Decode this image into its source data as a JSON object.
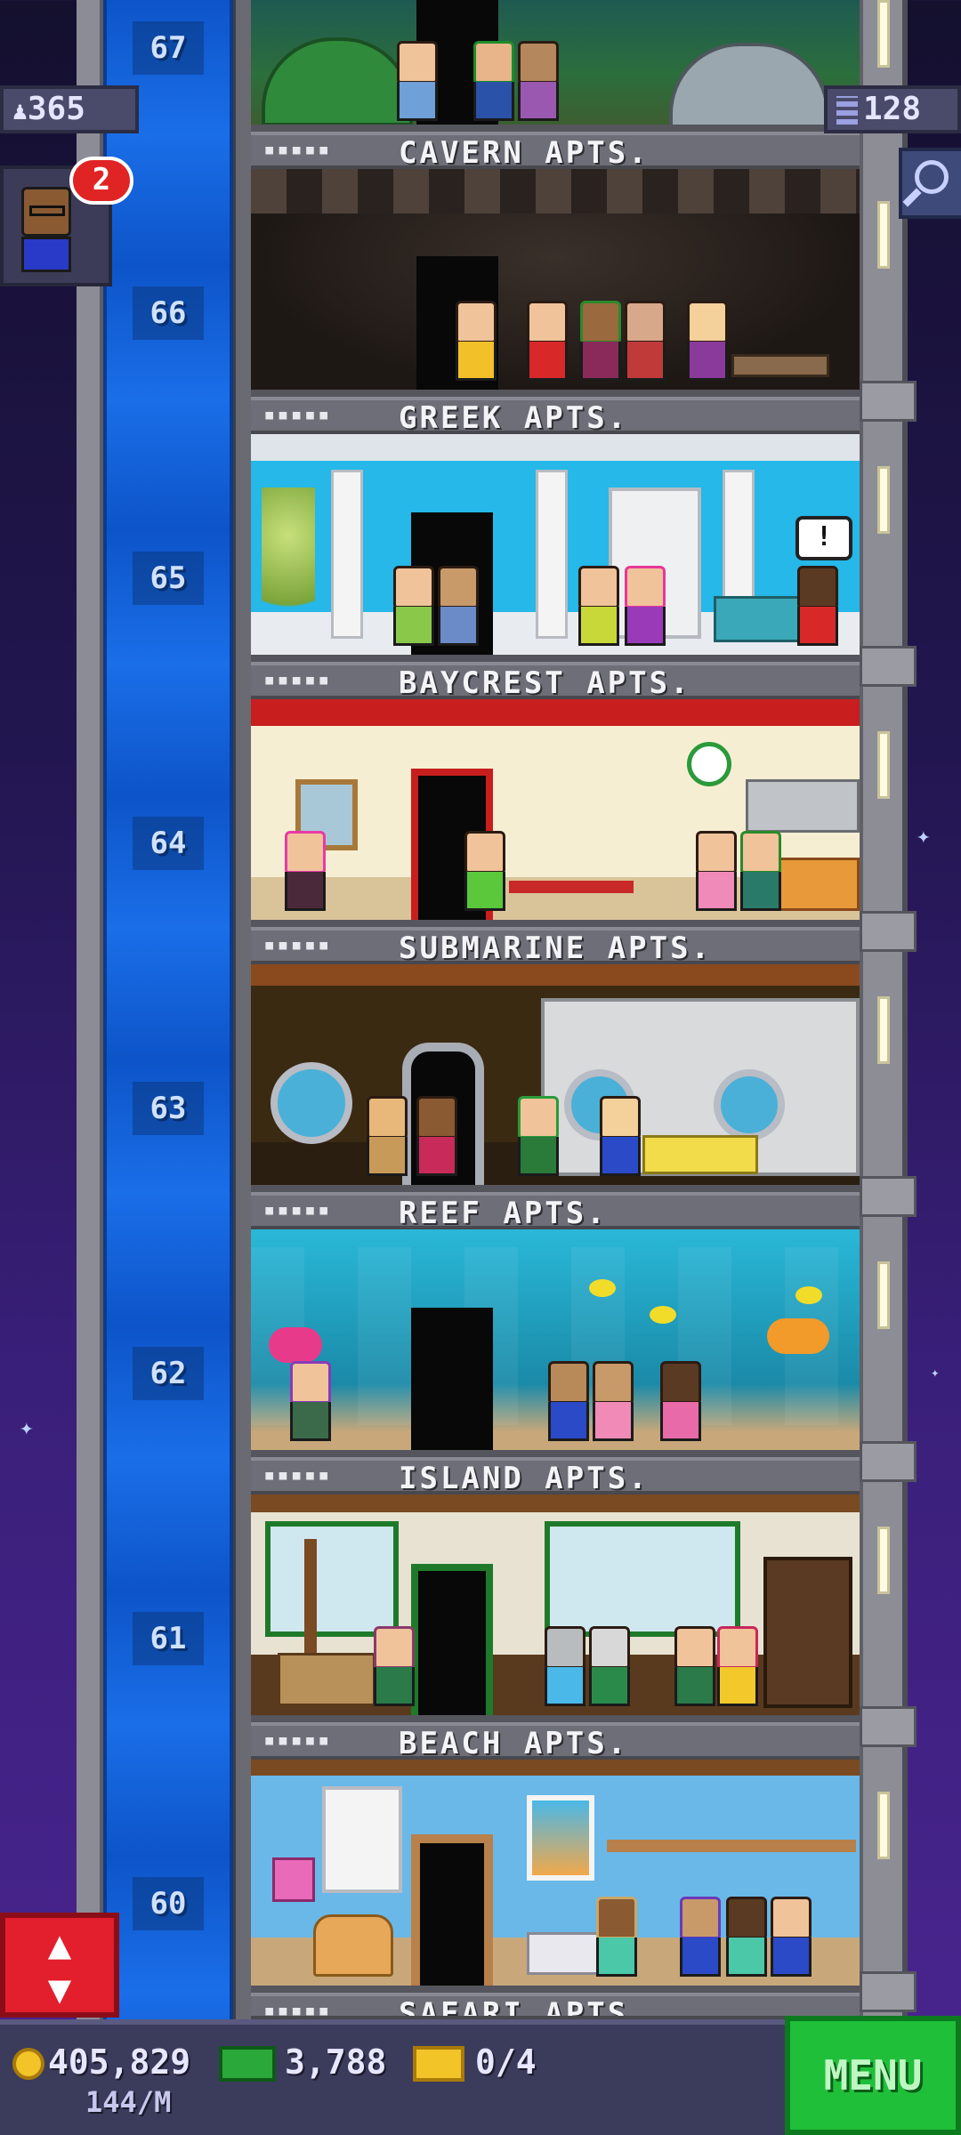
{
  "hud": {
    "population": "365",
    "floors": "128",
    "vip_badge_count": "2",
    "population_icon": "person-icon",
    "floors_icon": "building-icon",
    "search_icon": "magnifier-icon"
  },
  "floors": [
    {
      "number": "67",
      "name": "CAVERN APTS.",
      "stars": "▪▪▪▪▪"
    },
    {
      "number": "66",
      "name": "GREEK APTS.",
      "stars": "▪▪▪▪▪"
    },
    {
      "number": "65",
      "name": "BAYCREST APTS.",
      "stars": "▪▪▪▪▪"
    },
    {
      "number": "64",
      "name": "SUBMARINE APTS.",
      "stars": "▪▪▪▪▪"
    },
    {
      "number": "63",
      "name": "REEF APTS.",
      "stars": "▪▪▪▪▪"
    },
    {
      "number": "62",
      "name": "ISLAND APTS.",
      "stars": "▪▪▪▪▪"
    },
    {
      "number": "61",
      "name": "BEACH APTS.",
      "stars": "▪▪▪▪▪"
    },
    {
      "number": "60",
      "name": "SAFARI APTS.",
      "stars": "▪▪▪▪▪"
    }
  ],
  "bottom": {
    "coins": "405,829",
    "coin_rate": "144/M",
    "bux": "3,788",
    "tickets": "0/4",
    "menu_label": "MENU"
  },
  "colors": {
    "shaft_blue": "#1a6ee8",
    "menu_green": "#1fbf3a",
    "elevator_red": "#e31e2d",
    "badge_red": "#e02424"
  }
}
